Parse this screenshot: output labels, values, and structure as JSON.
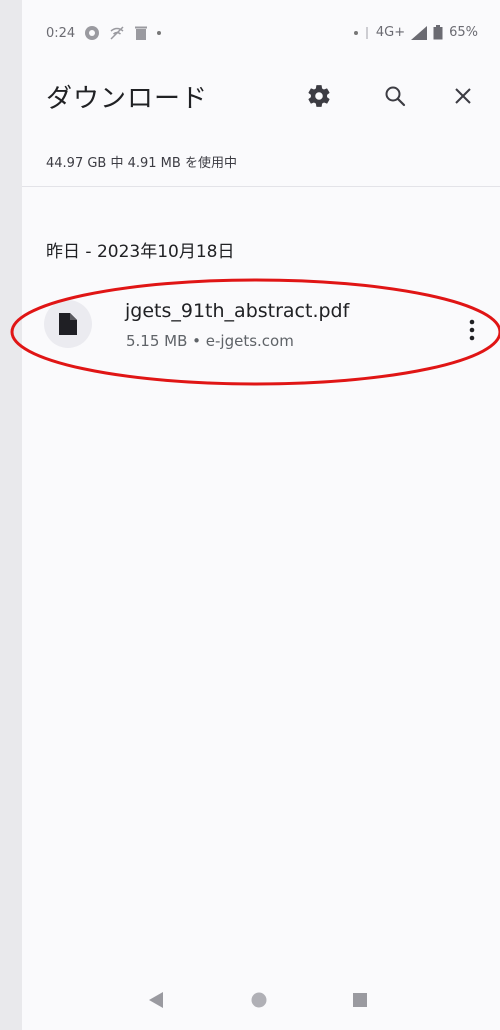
{
  "status_bar": {
    "time": "0:24",
    "network": "4G+",
    "battery": "65%"
  },
  "toolbar": {
    "title": "ダウンロード"
  },
  "storage_info": "44.97 GB 中 4.91 MB を使用中",
  "section": {
    "date_header": "昨日 - 2023年10月18日"
  },
  "download_items": [
    {
      "file_name": "jgets_91th_abstract.pdf",
      "meta": "5.15 MB • e-jgets.com"
    }
  ],
  "colors": {
    "highlight": "#e01515",
    "background": "#fafafc"
  },
  "icons": {
    "file": "file-icon",
    "settings": "gear-icon",
    "search": "search-icon",
    "close": "close-icon",
    "more": "more-vert-icon"
  }
}
